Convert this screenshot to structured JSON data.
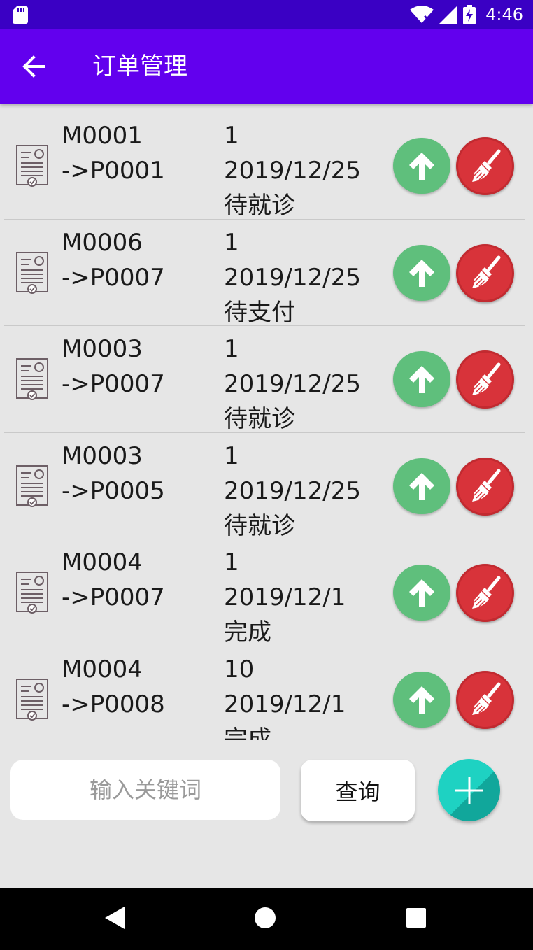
{
  "status_bar": {
    "time": "4:46"
  },
  "app_bar": {
    "title": "订单管理"
  },
  "orders": [
    {
      "id_line": "M0001",
      "target_line": "->P0001",
      "qty": "1",
      "date": "2019/12/25",
      "status": "待就诊"
    },
    {
      "id_line": "M0006",
      "target_line": "->P0007",
      "qty": "1",
      "date": "2019/12/25",
      "status": "待支付"
    },
    {
      "id_line": "M0003",
      "target_line": "->P0007",
      "qty": "1",
      "date": "2019/12/25",
      "status": "待就诊"
    },
    {
      "id_line": "M0003",
      "target_line": "->P0005",
      "qty": "1",
      "date": "2019/12/25",
      "status": "待就诊"
    },
    {
      "id_line": "M0004",
      "target_line": "->P0007",
      "qty": "1",
      "date": "2019/12/1",
      "status": "完成"
    },
    {
      "id_line": "M0004",
      "target_line": "->P0008",
      "qty": "10",
      "date": "2019/12/1",
      "status": "完成"
    }
  ],
  "search": {
    "placeholder": "输入关键词",
    "value": ""
  },
  "query_button": {
    "label": "查询"
  },
  "icons": {
    "row_icon": "invoice-document-icon",
    "upload": "arrow-up-icon",
    "clean": "broom-icon",
    "add": "plus-icon"
  },
  "colors": {
    "app_bar": "#6200ee",
    "status_bar": "#3a00c4",
    "upload_button": "#5fbf7c",
    "clean_button": "#d8333a",
    "fab": "#1ed2c2"
  }
}
